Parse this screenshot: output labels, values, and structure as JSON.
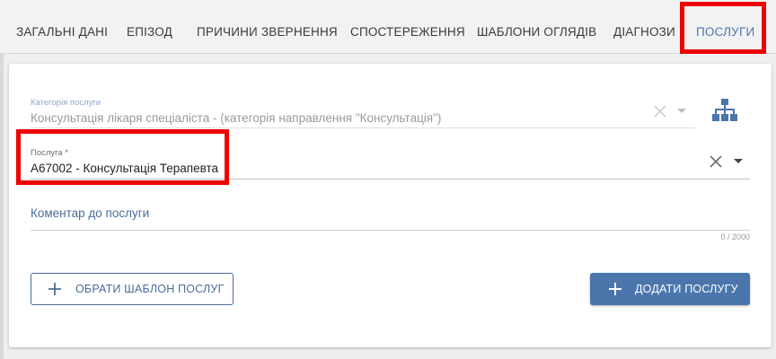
{
  "tabs": [
    {
      "label": "ЗАГАЛЬНІ ДАНІ"
    },
    {
      "label": "ЕПІЗОД"
    },
    {
      "label": "ПРИЧИНИ ЗВЕРНЕННЯ"
    },
    {
      "label": "СПОСТЕРЕЖЕННЯ"
    },
    {
      "label": "ШАБЛОНИ ОГЛЯДІВ"
    },
    {
      "label": "ДІАГНОЗИ"
    },
    {
      "label": "ПОСЛУГИ",
      "active": true
    }
  ],
  "form": {
    "category": {
      "label": "Категорія послуги",
      "value": "Консультація лікаря спеціаліста - (категорія направлення \"Консультація\")",
      "disabled": true
    },
    "service": {
      "label": "Послуга *",
      "value": "А67002 - Консультація Терапевта"
    },
    "comment": {
      "placeholder": "Коментар до послуги",
      "value": "",
      "counter": "0 / 2000"
    }
  },
  "buttons": {
    "select_template": "ОБРАТИ ШАБЛОН ПОСЛУГ",
    "add_service": "ДОДАТИ ПОСЛУГУ"
  },
  "icons": {
    "clear": "close-icon",
    "dropdown": "chevron-down-icon",
    "tree": "hierarchy-icon",
    "add": "plus-icon"
  },
  "colors": {
    "accent": "#4a76ac",
    "highlight": "#ee0000",
    "text": "#333333"
  }
}
